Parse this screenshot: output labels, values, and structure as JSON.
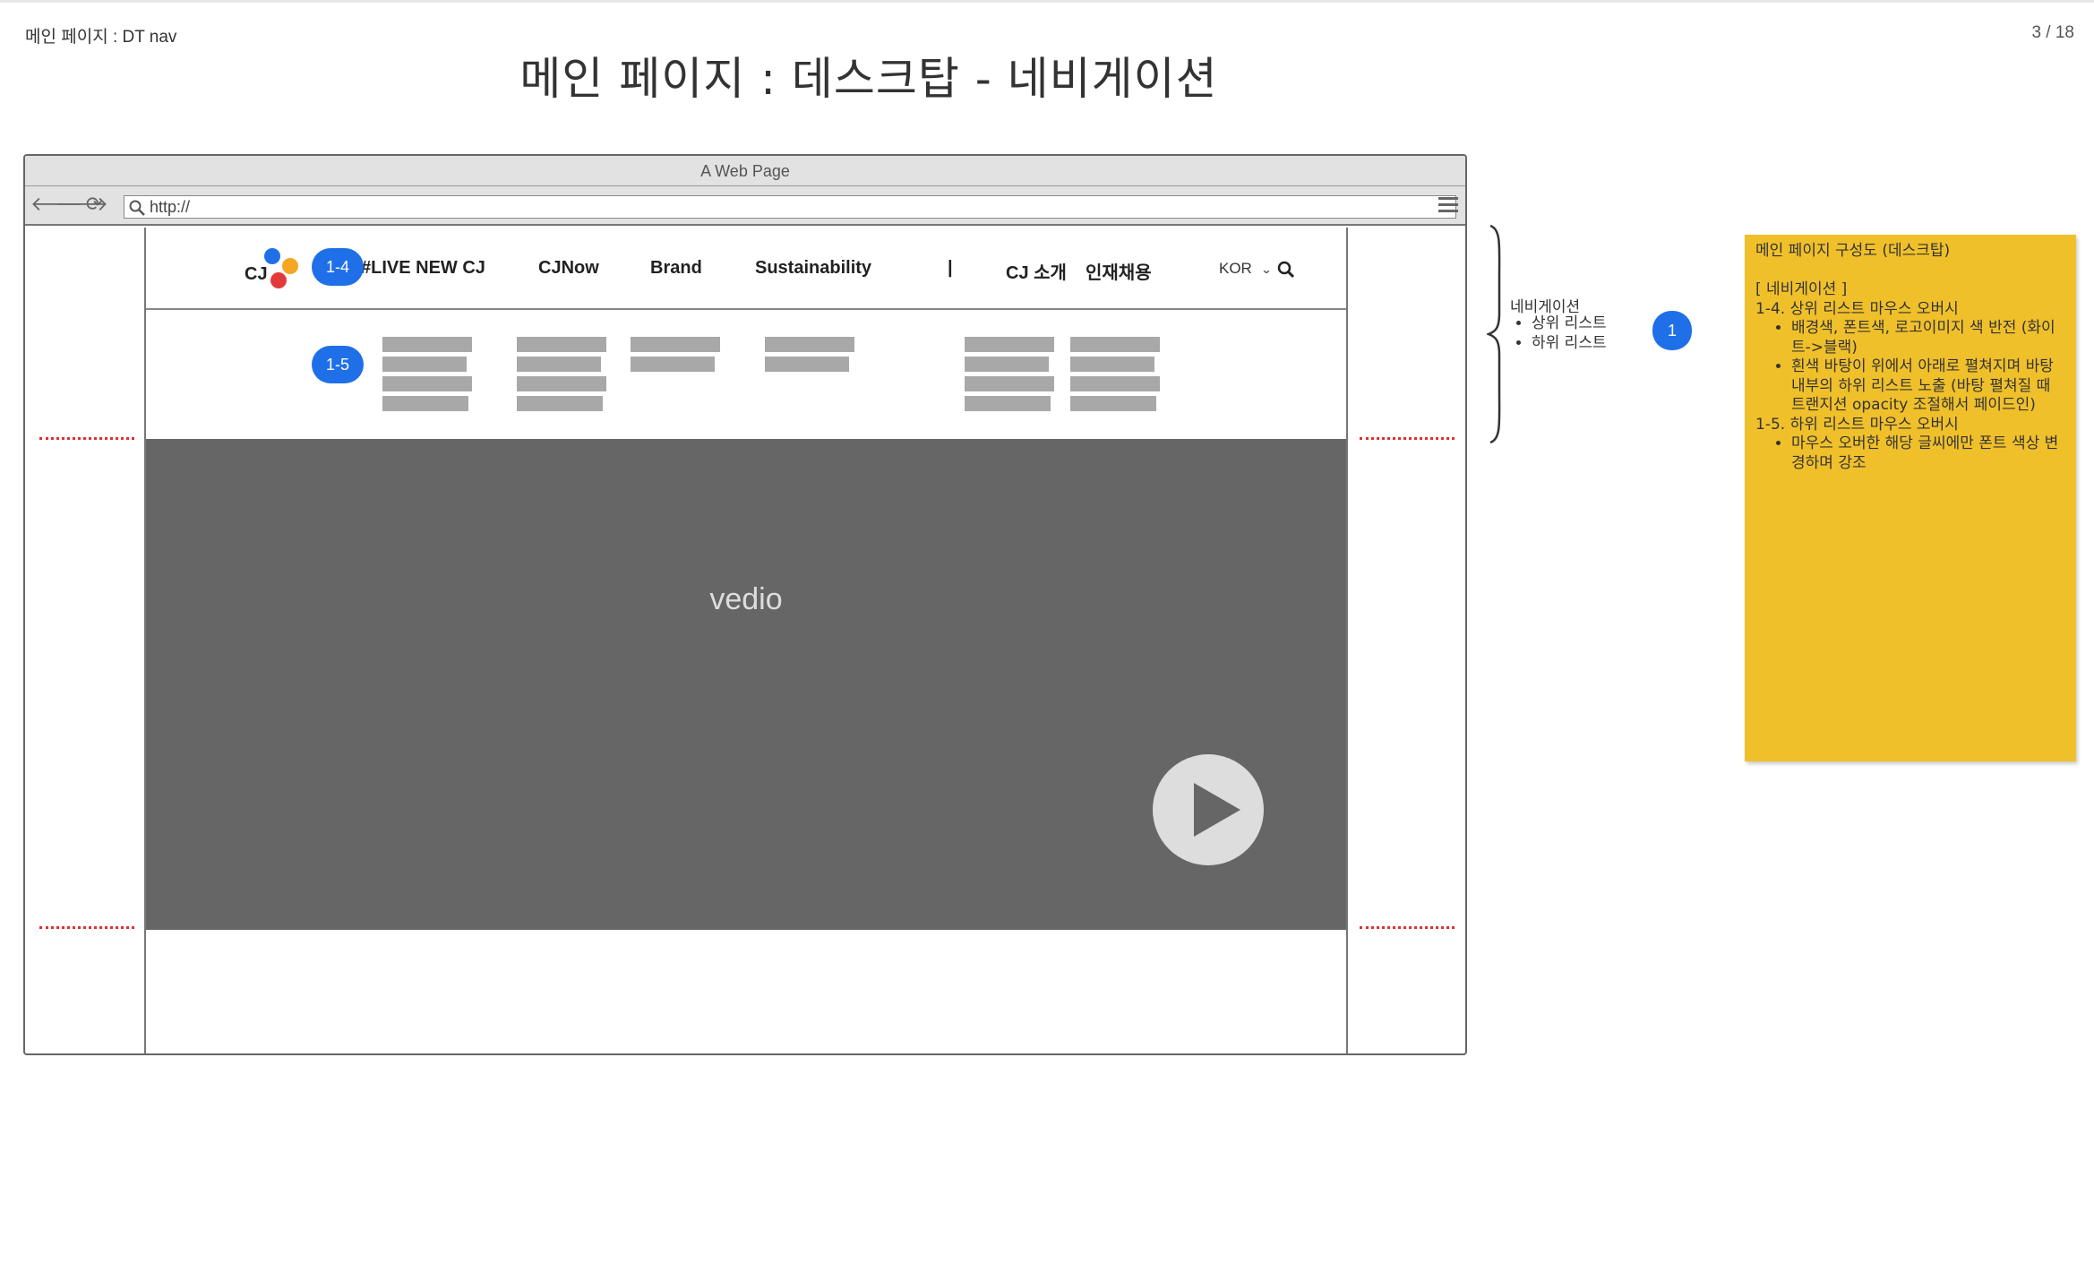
{
  "slide": {
    "label": "메인 페이지 : DT nav",
    "page_number": "3 / 18",
    "title": "메인 페이지 : 데스크탑 - 네비게이션"
  },
  "browser": {
    "window_title": "A Web Page",
    "url": "http://"
  },
  "site": {
    "logo_text": "CJ",
    "nav_items": [
      "#LIVE NEW CJ",
      "CJNow",
      "Brand",
      "Sustainability",
      "|",
      "CJ 소개",
      "인재채용"
    ],
    "language": "KOR",
    "video_label": "vedio"
  },
  "badges": {
    "top_list": "1-4",
    "sub_list": "1-5",
    "section": "1"
  },
  "annotation": {
    "title": "네비게이션",
    "items": [
      "상위 리스트",
      "하위 리스트"
    ]
  },
  "note": {
    "heading": "메인 페이지 구성도 (데스크탑)",
    "section": "[ 네비게이션 ]",
    "item1_title": "1-4. 상위 리스트 마우스 오버시",
    "item1_bullets": [
      "배경색, 폰트색, 로고이미지 색 반전 (화이트->블랙)",
      "흰색 바탕이 위에서 아래로 펼쳐지며 바탕 내부의 하위 리스트 노출 (바탕 펼쳐질 때 트랜지션 opacity 조절해서 페이드인)"
    ],
    "item2_title": "1-5. 하위 리스트 마우스 오버시",
    "item2_bullets": [
      "마우스 오버한 해당 글씨에만 폰트 색상 변경하며 강조"
    ]
  },
  "colors": {
    "badge": "#1f6fe8",
    "note": "#f0c02b",
    "video": "#666666",
    "guide_dots": "#e03030"
  }
}
